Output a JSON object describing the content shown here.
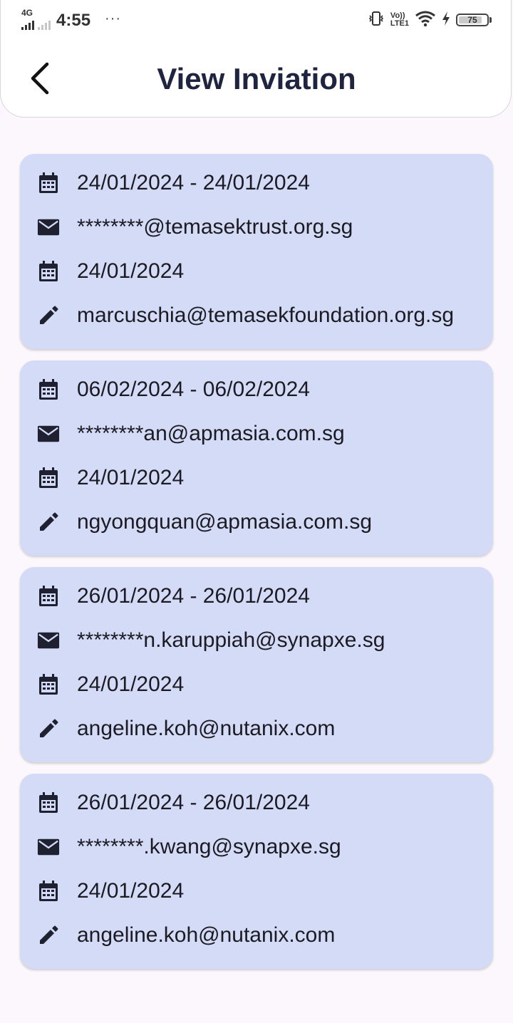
{
  "status_bar": {
    "network_label": "4G",
    "time": "4:55",
    "more_indicator": "···",
    "volte_label_line1": "Vo))",
    "volte_label_line2": "LTE1",
    "battery_level": "75",
    "icons": [
      "signal-icon",
      "vibrate-icon",
      "wifi-icon",
      "charging-icon",
      "battery-icon"
    ]
  },
  "header": {
    "title": "View Inviation",
    "back_icon": "chevron-left-icon"
  },
  "colors": {
    "card_background": "#d4dbf6",
    "page_background": "#fcf7fc",
    "title_color": "#1f2540"
  },
  "invitations": [
    {
      "date_range": "24/01/2024 - 24/01/2024",
      "email": "********@temasektrust.org.sg",
      "created_date": "24/01/2024",
      "created_by": "marcuschia@temasekfoundation.org.sg"
    },
    {
      "date_range": "06/02/2024 - 06/02/2024",
      "email": "********an@apmasia.com.sg",
      "created_date": "24/01/2024",
      "created_by": "ngyongquan@apmasia.com.sg"
    },
    {
      "date_range": "26/01/2024 - 26/01/2024",
      "email": "********n.karuppiah@synapxe.sg",
      "created_date": "24/01/2024",
      "created_by": "angeline.koh@nutanix.com"
    },
    {
      "date_range": "26/01/2024 - 26/01/2024",
      "email": "********.kwang@synapxe.sg",
      "created_date": "24/01/2024",
      "created_by": "angeline.koh@nutanix.com"
    }
  ]
}
